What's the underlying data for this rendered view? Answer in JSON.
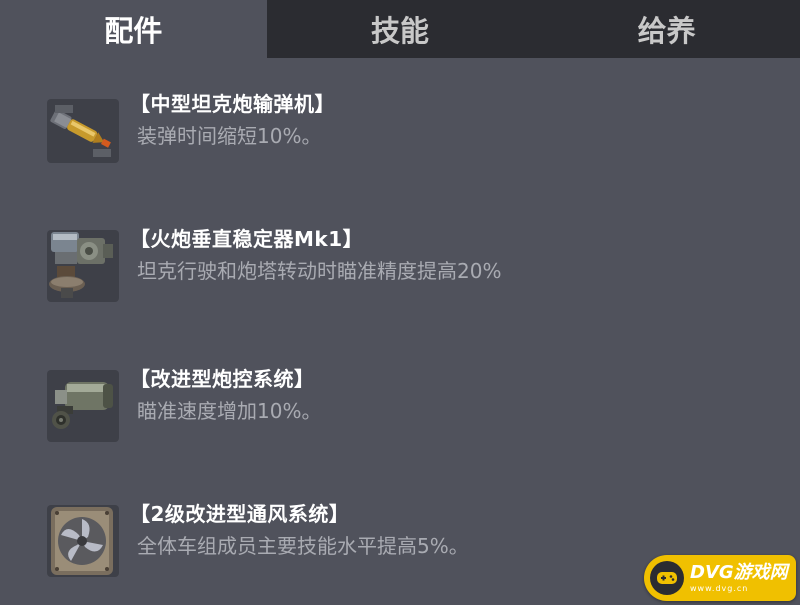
{
  "tabs": [
    {
      "label": "配件",
      "active": true
    },
    {
      "label": "技能",
      "active": false
    },
    {
      "label": "给养",
      "active": false
    }
  ],
  "items": [
    {
      "icon": "autoloader-icon",
      "title": "【中型坦克炮输弹机】",
      "desc": "装弹时间缩短10%。"
    },
    {
      "icon": "gun-stabilizer-icon",
      "title": "【火炮垂直稳定器Mk1】",
      "desc": "坦克行驶和炮塔转动时瞄准精度提高20%"
    },
    {
      "icon": "gun-laying-drive-icon",
      "title": "【改进型炮控系统】",
      "desc": "瞄准速度增加10%。"
    },
    {
      "icon": "ventilation-icon",
      "title": "【2级改进型通风系统】",
      "desc": "全体车组成员主要技能水平提高5%。"
    }
  ],
  "watermark": {
    "main": "DVG游戏网",
    "sub": "www.dvg.cn",
    "color": "#f0c000"
  },
  "colors": {
    "background": "#50525c",
    "tab_bar": "#2b2c31",
    "title": "#ffffff",
    "desc": "#a9abb2"
  }
}
